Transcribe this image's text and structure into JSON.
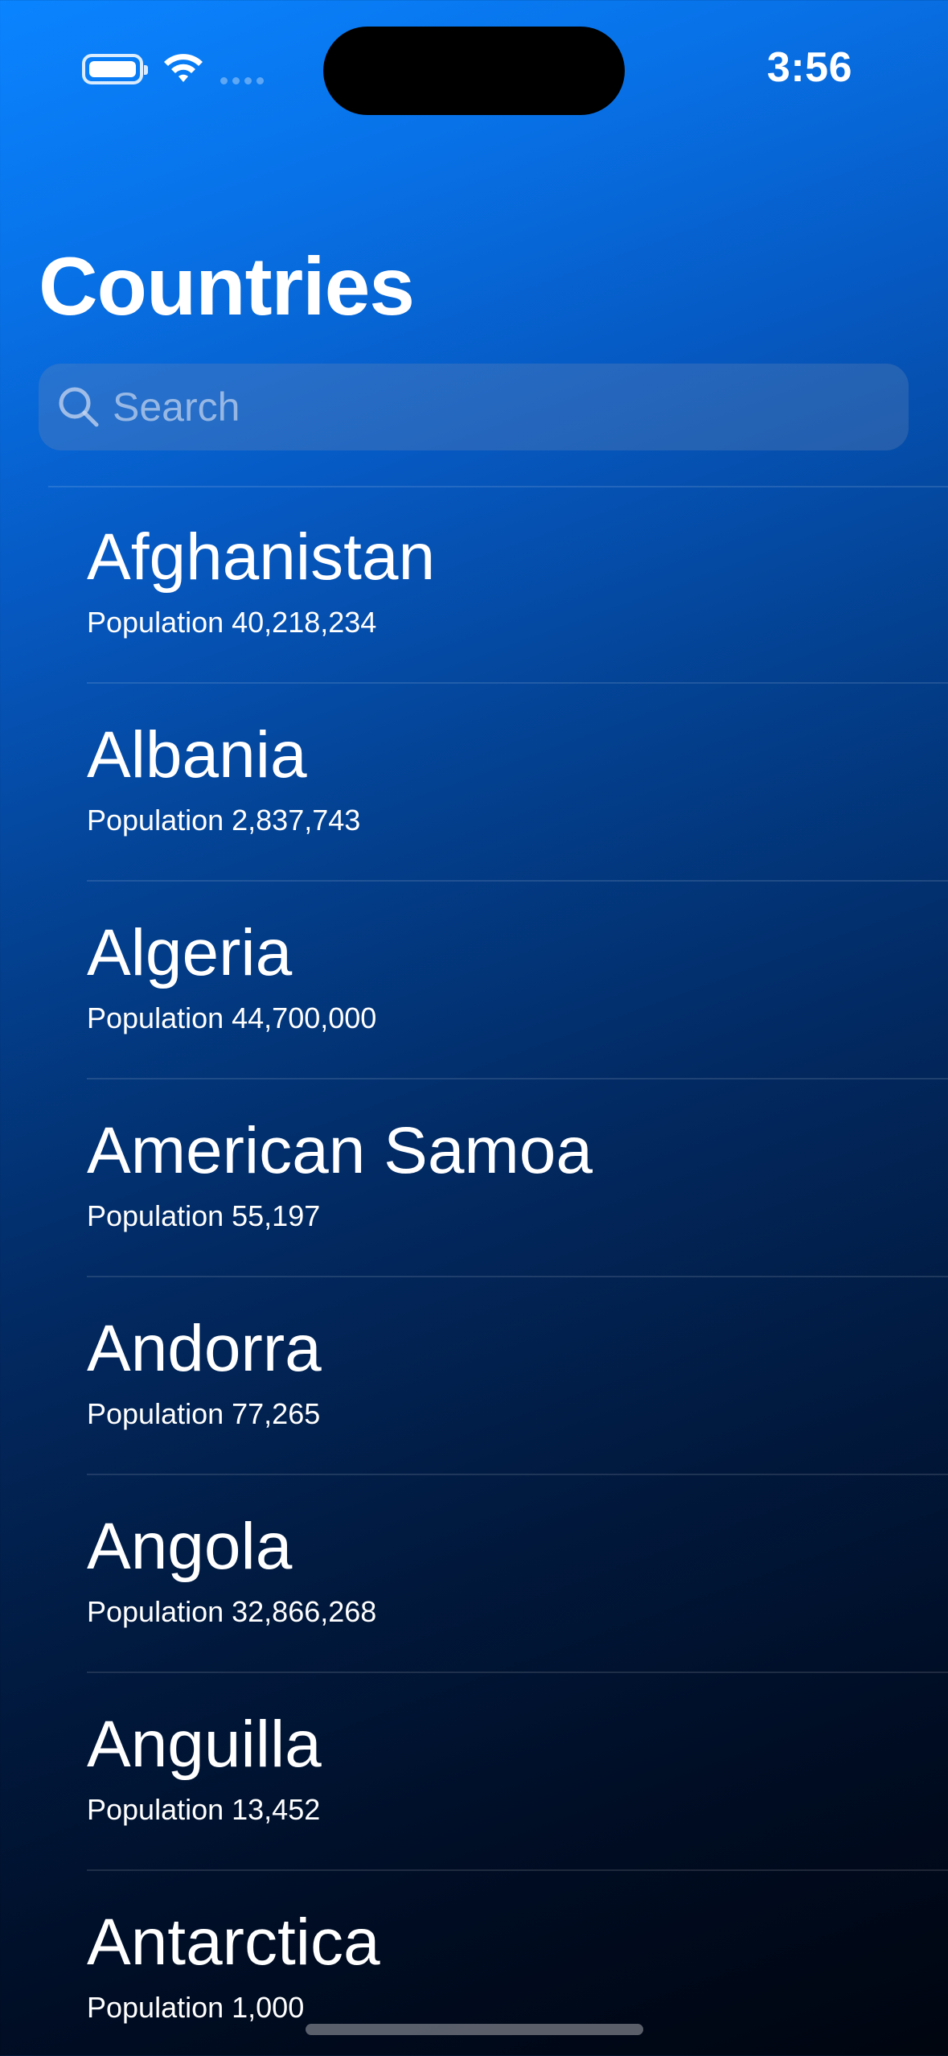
{
  "status_bar": {
    "time": "3:56"
  },
  "header": {
    "title": "Countries"
  },
  "search": {
    "placeholder": "Search",
    "value": ""
  },
  "countries": [
    {
      "name": "Afghanistan",
      "population": "Population 40,218,234"
    },
    {
      "name": "Albania",
      "population": "Population 2,837,743"
    },
    {
      "name": "Algeria",
      "population": "Population 44,700,000"
    },
    {
      "name": "American Samoa",
      "population": "Population 55,197"
    },
    {
      "name": "Andorra",
      "population": "Population 77,265"
    },
    {
      "name": "Angola",
      "population": "Population 32,866,268"
    },
    {
      "name": "Anguilla",
      "population": "Population 13,452"
    },
    {
      "name": "Antarctica",
      "population": "Population 1,000"
    }
  ],
  "icons": {
    "battery": "battery-icon",
    "wifi": "wifi-icon",
    "signal": "cellular-signal-icon",
    "search": "search-icon"
  },
  "colors": {
    "gradient_top": "#0a84ff",
    "gradient_bottom": "#00050f",
    "text": "#ffffff"
  }
}
